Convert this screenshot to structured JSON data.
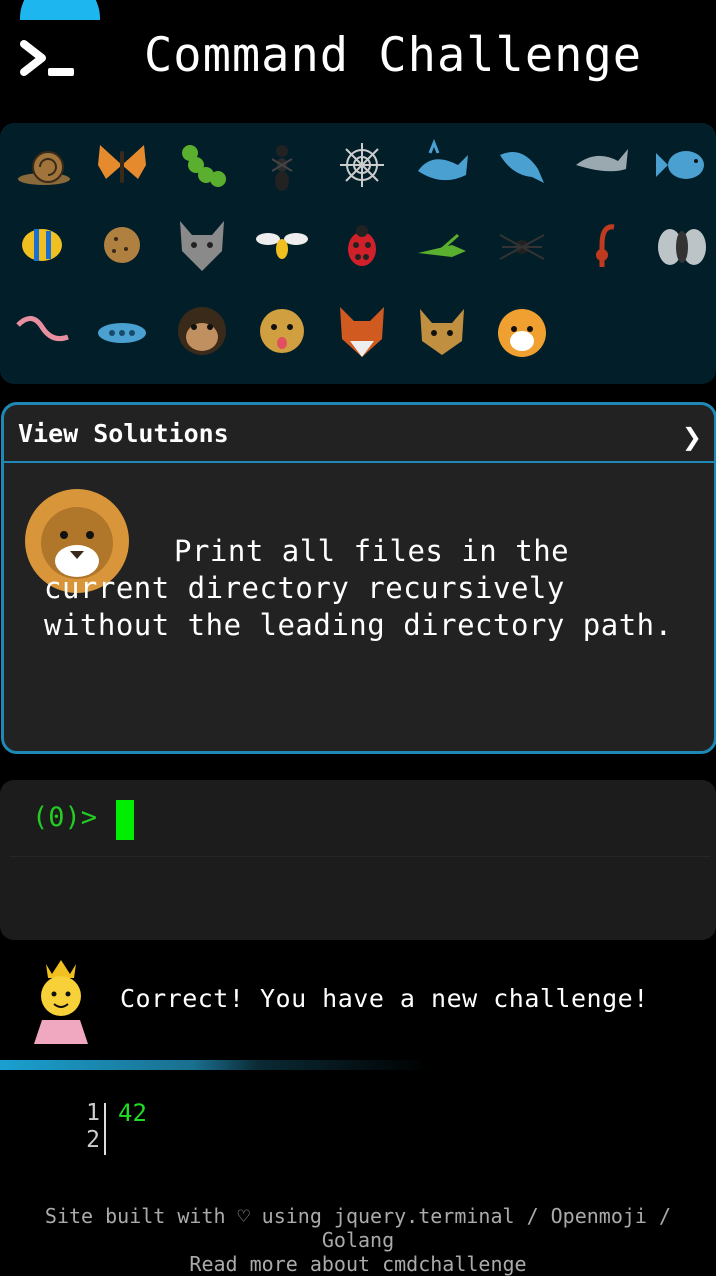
{
  "header": {
    "title": "Command Challenge",
    "logo_icon": "terminal-prompt-icon"
  },
  "animals": {
    "rows": [
      [
        "snail",
        "butterfly",
        "caterpillar",
        "ant",
        "spider-web",
        "whale",
        "spouting-whale",
        "dolphin",
        "fish"
      ],
      [
        "tropical-fish",
        "blowfish",
        "wolf",
        "honeybee",
        "lady-beetle",
        "cricket",
        "spider",
        "scorpion",
        "fly"
      ],
      [
        "worm",
        "microbe",
        "monkey",
        "dog",
        "fox",
        "cat",
        "tiger"
      ]
    ]
  },
  "solutions": {
    "title": "View Solutions",
    "chevron": "❯",
    "icon": "lion-icon",
    "challenge": "Print all files in the current directory recursively without the leading directory path."
  },
  "terminal": {
    "prompt": "(0)>"
  },
  "status": {
    "icon": "princess-icon",
    "message": "Correct! You have a new challenge!"
  },
  "progress": {
    "fraction": 0.6
  },
  "code": {
    "line_numbers": [
      "1",
      "2"
    ],
    "lines": [
      "42"
    ]
  },
  "footer": {
    "line1": "Site built with ♡ using jquery.terminal / Openmoji /",
    "line2": "Golang",
    "line3": "Read more about cmdchallenge"
  },
  "colors": {
    "accent": "#1eb6ee",
    "panel": "#021e29",
    "prompt_green": "#22cc22"
  }
}
